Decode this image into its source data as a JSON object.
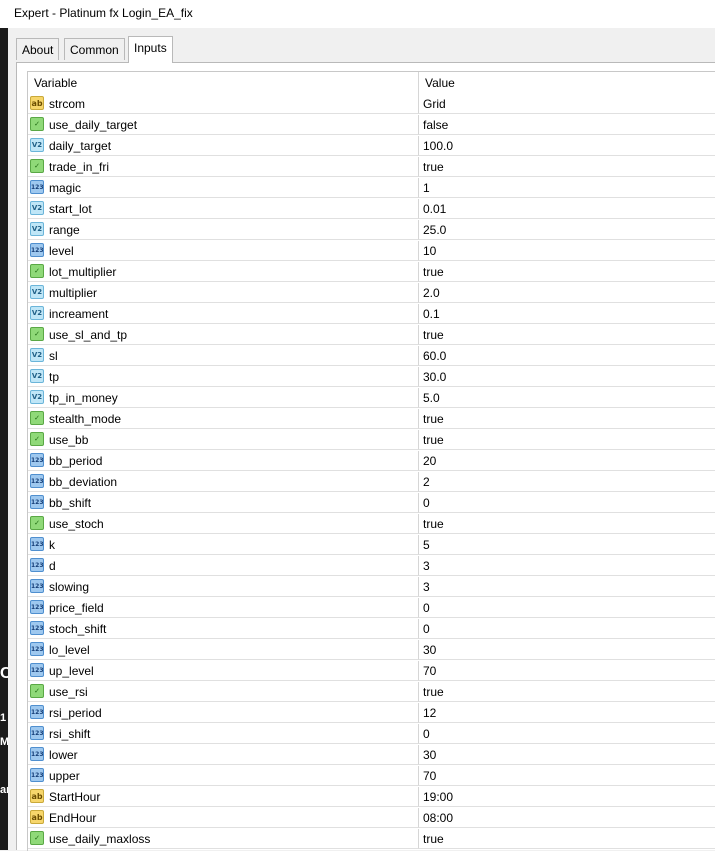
{
  "window": {
    "title": "Expert - Platinum fx Login_EA_fix"
  },
  "tabs": [
    {
      "label": "About",
      "active": false
    },
    {
      "label": "Common",
      "active": false
    },
    {
      "label": "Inputs",
      "active": true
    }
  ],
  "table": {
    "headers": {
      "variable": "Variable",
      "value": "Value"
    },
    "rows": [
      {
        "type": "string",
        "icon": "string-type-icon",
        "name": "strcom",
        "value": "Grid"
      },
      {
        "type": "bool",
        "icon": "bool-type-icon",
        "name": "use_daily_target",
        "value": "false"
      },
      {
        "type": "double",
        "icon": "double-type-icon",
        "name": "daily_target",
        "value": "100.0"
      },
      {
        "type": "bool",
        "icon": "bool-type-icon",
        "name": "trade_in_fri",
        "value": "true"
      },
      {
        "type": "int",
        "icon": "int-type-icon",
        "name": "magic",
        "value": "1"
      },
      {
        "type": "double",
        "icon": "double-type-icon",
        "name": "start_lot",
        "value": "0.01"
      },
      {
        "type": "double",
        "icon": "double-type-icon",
        "name": "range",
        "value": "25.0"
      },
      {
        "type": "int",
        "icon": "int-type-icon",
        "name": "level",
        "value": "10"
      },
      {
        "type": "bool",
        "icon": "bool-type-icon",
        "name": "lot_multiplier",
        "value": "true"
      },
      {
        "type": "double",
        "icon": "double-type-icon",
        "name": "multiplier",
        "value": "2.0"
      },
      {
        "type": "double",
        "icon": "double-type-icon",
        "name": "increament",
        "value": "0.1"
      },
      {
        "type": "bool",
        "icon": "bool-type-icon",
        "name": "use_sl_and_tp",
        "value": "true"
      },
      {
        "type": "double",
        "icon": "double-type-icon",
        "name": "sl",
        "value": "60.0"
      },
      {
        "type": "double",
        "icon": "double-type-icon",
        "name": "tp",
        "value": "30.0"
      },
      {
        "type": "double",
        "icon": "double-type-icon",
        "name": "tp_in_money",
        "value": "5.0"
      },
      {
        "type": "bool",
        "icon": "bool-type-icon",
        "name": "stealth_mode",
        "value": "true"
      },
      {
        "type": "bool",
        "icon": "bool-type-icon",
        "name": "use_bb",
        "value": "true"
      },
      {
        "type": "int",
        "icon": "int-type-icon",
        "name": "bb_period",
        "value": "20"
      },
      {
        "type": "int",
        "icon": "int-type-icon",
        "name": "bb_deviation",
        "value": "2"
      },
      {
        "type": "int",
        "icon": "int-type-icon",
        "name": "bb_shift",
        "value": "0"
      },
      {
        "type": "bool",
        "icon": "bool-type-icon",
        "name": "use_stoch",
        "value": "true"
      },
      {
        "type": "int",
        "icon": "int-type-icon",
        "name": "k",
        "value": "5"
      },
      {
        "type": "int",
        "icon": "int-type-icon",
        "name": "d",
        "value": "3"
      },
      {
        "type": "int",
        "icon": "int-type-icon",
        "name": "slowing",
        "value": "3"
      },
      {
        "type": "int",
        "icon": "int-type-icon",
        "name": "price_field",
        "value": "0"
      },
      {
        "type": "int",
        "icon": "int-type-icon",
        "name": "stoch_shift",
        "value": "0"
      },
      {
        "type": "int",
        "icon": "int-type-icon",
        "name": "lo_level",
        "value": "30"
      },
      {
        "type": "int",
        "icon": "int-type-icon",
        "name": "up_level",
        "value": "70"
      },
      {
        "type": "bool",
        "icon": "bool-type-icon",
        "name": "use_rsi",
        "value": "true"
      },
      {
        "type": "int",
        "icon": "int-type-icon",
        "name": "rsi_period",
        "value": "12"
      },
      {
        "type": "int",
        "icon": "int-type-icon",
        "name": "rsi_shift",
        "value": "0"
      },
      {
        "type": "int",
        "icon": "int-type-icon",
        "name": "lower",
        "value": "30"
      },
      {
        "type": "int",
        "icon": "int-type-icon",
        "name": "upper",
        "value": "70"
      },
      {
        "type": "string",
        "icon": "string-type-icon",
        "name": "StartHour",
        "value": "19:00"
      },
      {
        "type": "string",
        "icon": "string-type-icon",
        "name": "EndHour",
        "value": "08:00"
      },
      {
        "type": "bool",
        "icon": "bool-type-icon",
        "name": "use_daily_maxloss",
        "value": "true"
      }
    ]
  },
  "colors": {
    "string_icon": "#f7d66b",
    "bool_icon": "#8fd978",
    "double_icon": "#bfe6f7",
    "int_icon": "#9ec8ef"
  }
}
